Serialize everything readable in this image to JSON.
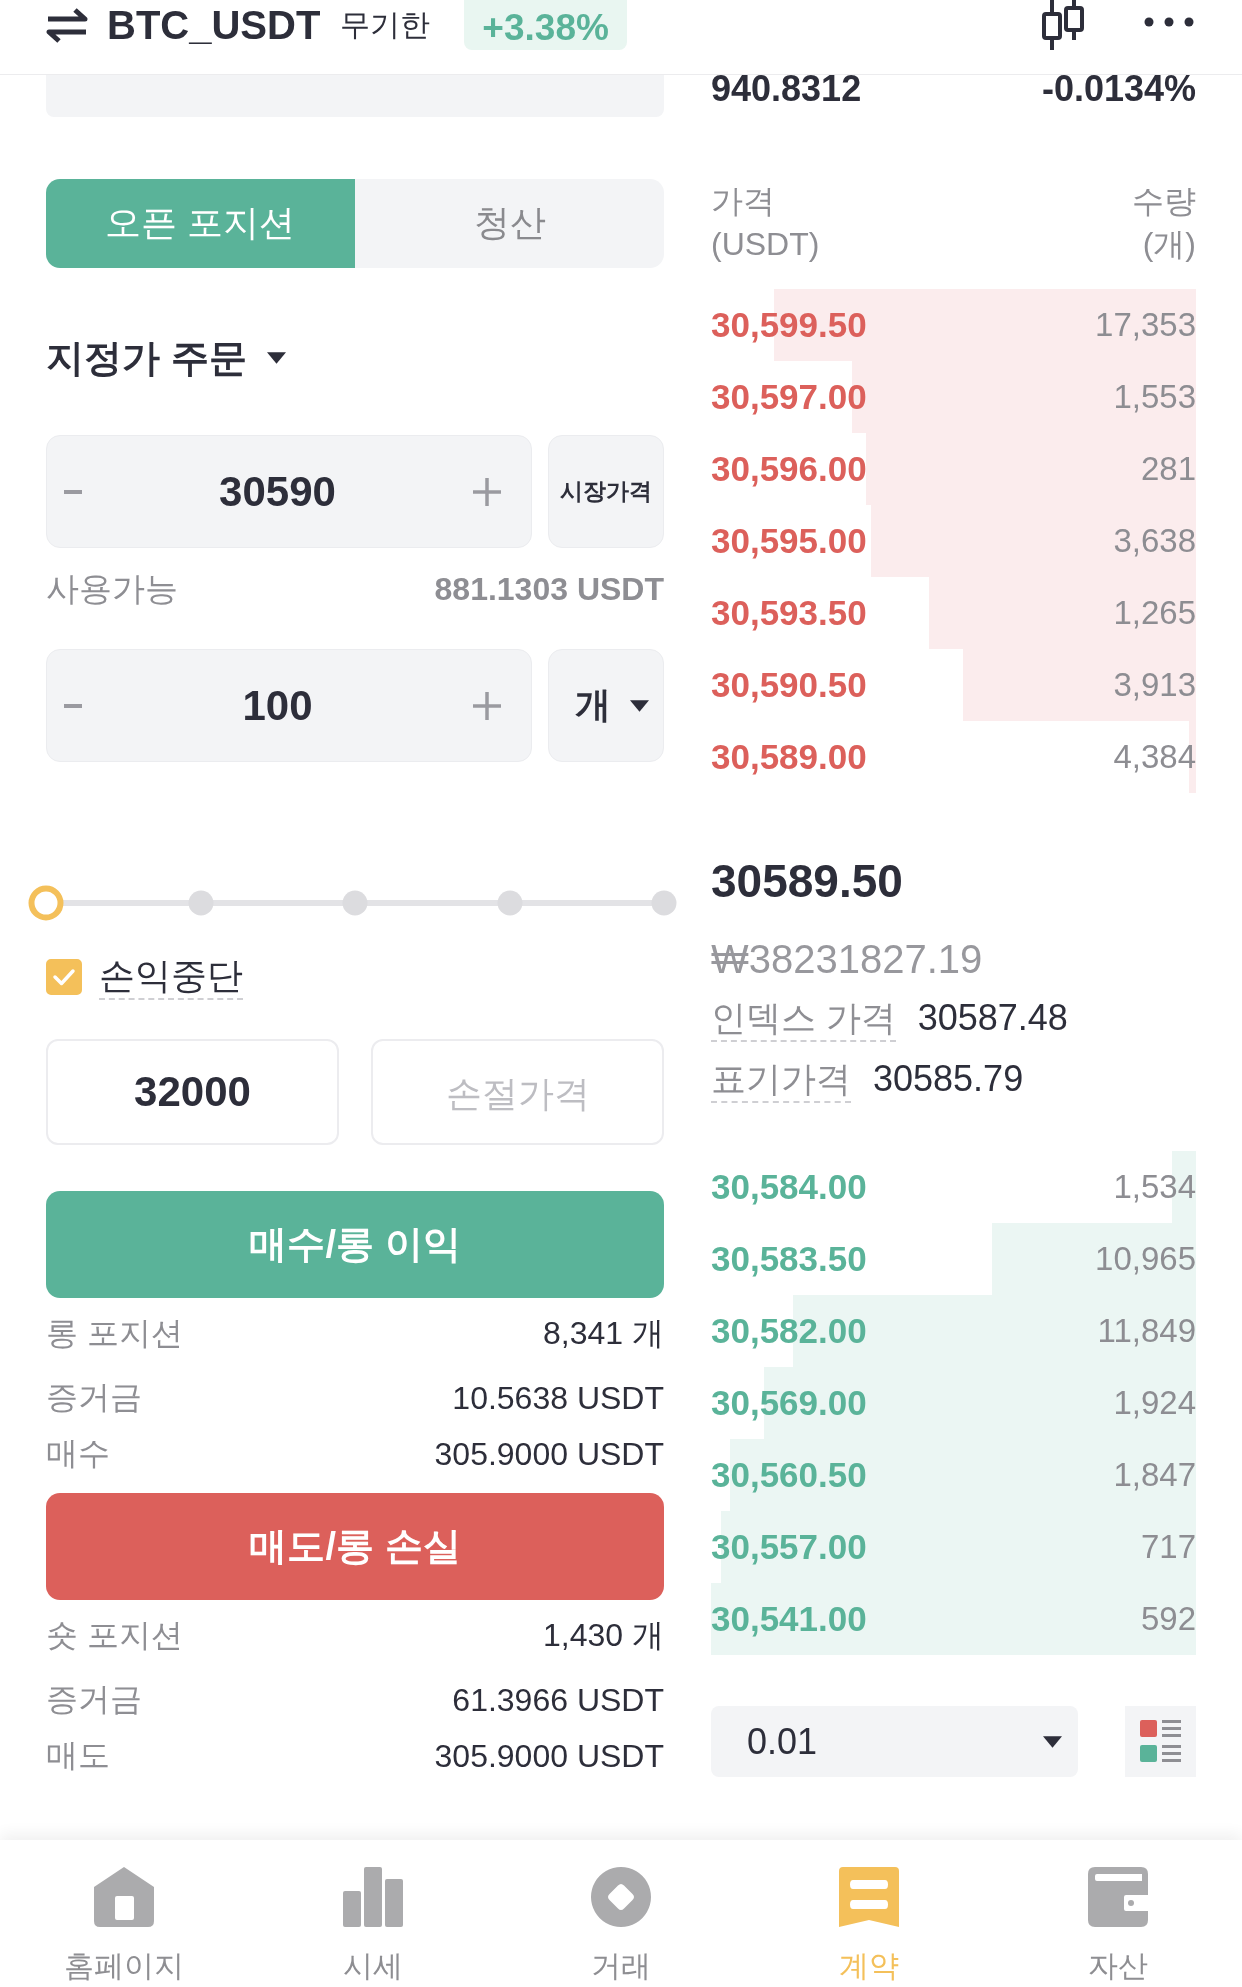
{
  "header": {
    "pair": "BTC_USDT",
    "contract_type": "무기한",
    "change": "+3.38%"
  },
  "ticker": {
    "value": "940.8312",
    "rate": "-0.0134%"
  },
  "order_form": {
    "tabs": [
      {
        "label": "오픈 포지션",
        "selected": true
      },
      {
        "label": "청산",
        "selected": false
      }
    ],
    "order_type": "지정가 주문",
    "price": {
      "value": "30590",
      "market_button": "시장가격"
    },
    "available": {
      "label": "사용가능",
      "value": "881.1303 USDT"
    },
    "quantity": {
      "value": "100",
      "unit": "개"
    },
    "slider": {
      "level": 0
    },
    "stop": {
      "label": "손익중단",
      "checked": true,
      "take_profit": {
        "value": "32000"
      },
      "stop_loss": {
        "placeholder": "손절가격"
      }
    },
    "actions": [
      {
        "kind": "buy",
        "label": "매수/롱 이익",
        "rows": [
          {
            "label": "롱 포지션",
            "value": "8,341 개"
          },
          {
            "label": "증거금",
            "value": "10.5638 USDT"
          },
          {
            "label": "매수",
            "value": "305.9000 USDT"
          }
        ]
      },
      {
        "kind": "sell",
        "label": "매도/롱 손실",
        "rows": [
          {
            "label": "숏 포지션",
            "value": "1,430 개"
          },
          {
            "label": "증거금",
            "value": "61.3966 USDT"
          },
          {
            "label": "매도",
            "value": "305.9000 USDT"
          }
        ]
      }
    ]
  },
  "orderbook": {
    "columns": [
      {
        "title": "가격",
        "unit": "(USDT)"
      },
      {
        "title": "수량",
        "unit": "(개)"
      }
    ],
    "asks": [
      {
        "price": "30,599.50",
        "amount": "17,353"
      },
      {
        "price": "30,597.00",
        "amount": "1,553"
      },
      {
        "price": "30,596.00",
        "amount": "281"
      },
      {
        "price": "30,595.00",
        "amount": "3,638"
      },
      {
        "price": "30,593.50",
        "amount": "1,265"
      },
      {
        "price": "30,590.50",
        "amount": "3,913"
      },
      {
        "price": "30,589.00",
        "amount": "4,384"
      }
    ],
    "last_price": "30589.50",
    "krw_price": "₩38231827.19",
    "index_price": {
      "label": "인덱스 가격",
      "value": "30587.48"
    },
    "mark_price": {
      "label": "표기가격",
      "value": "30585.79"
    },
    "bids": [
      {
        "price": "30,584.00",
        "amount": "1,534"
      },
      {
        "price": "30,583.50",
        "amount": "10,965"
      },
      {
        "price": "30,582.00",
        "amount": "11,849"
      },
      {
        "price": "30,569.00",
        "amount": "1,924"
      },
      {
        "price": "30,560.50",
        "amount": "1,847"
      },
      {
        "price": "30,557.00",
        "amount": "717"
      },
      {
        "price": "30,541.00",
        "amount": "592"
      }
    ],
    "depth": "0.01"
  },
  "bottom_nav": [
    {
      "label": "홈페이지",
      "selected": false
    },
    {
      "label": "시세",
      "selected": false
    },
    {
      "label": "거래",
      "selected": false
    },
    {
      "label": "계약",
      "selected": true
    },
    {
      "label": "자산",
      "selected": false
    }
  ]
}
